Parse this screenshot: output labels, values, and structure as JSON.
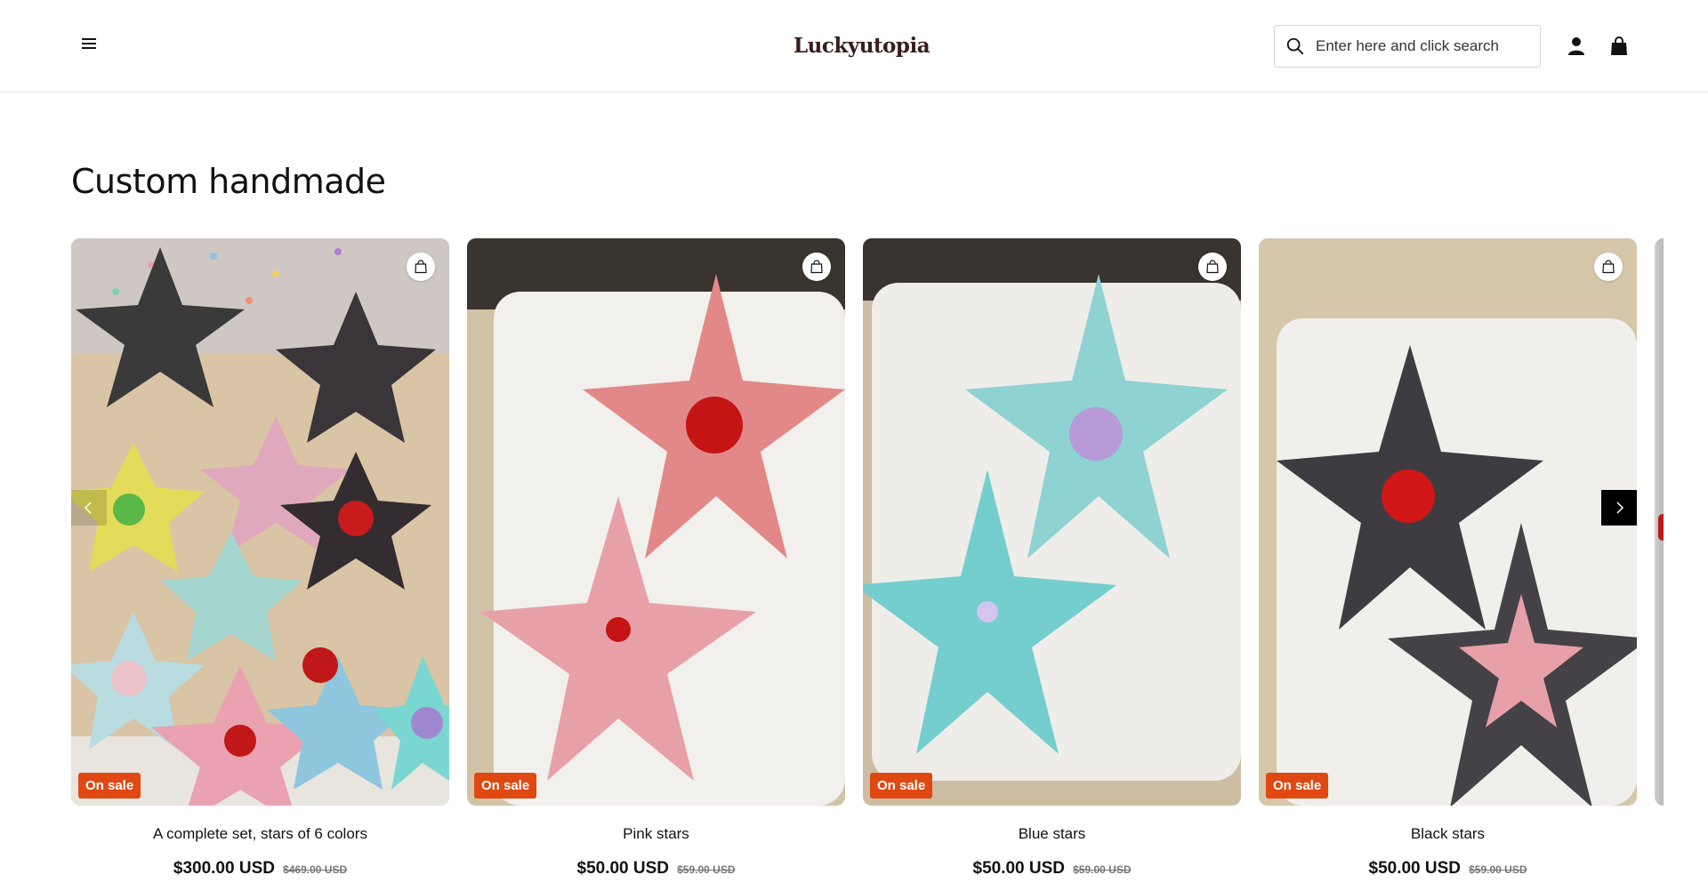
{
  "header": {
    "logo_text": "Luckyutopia",
    "search_placeholder": "Enter here and click search",
    "icons": [
      "menu-icon",
      "search-icon",
      "account-icon",
      "cart-icon"
    ]
  },
  "section": {
    "title": "Custom handmade"
  },
  "products": [
    {
      "title": "A complete set, stars of 6 colors",
      "price": "$300.00 USD",
      "compare_price": "$469.00 USD",
      "badge": "On sale"
    },
    {
      "title": "Pink stars",
      "price": "$50.00 USD",
      "compare_price": "$59.00 USD",
      "badge": "On sale"
    },
    {
      "title": "Blue stars",
      "price": "$50.00 USD",
      "compare_price": "$59.00 USD",
      "badge": "On sale"
    },
    {
      "title": "Black stars",
      "price": "$50.00 USD",
      "compare_price": "$59.00 USD",
      "badge": "On sale"
    }
  ],
  "colors": {
    "badge": "#e04812",
    "text": "#121212",
    "border": "#e6e6e6"
  }
}
